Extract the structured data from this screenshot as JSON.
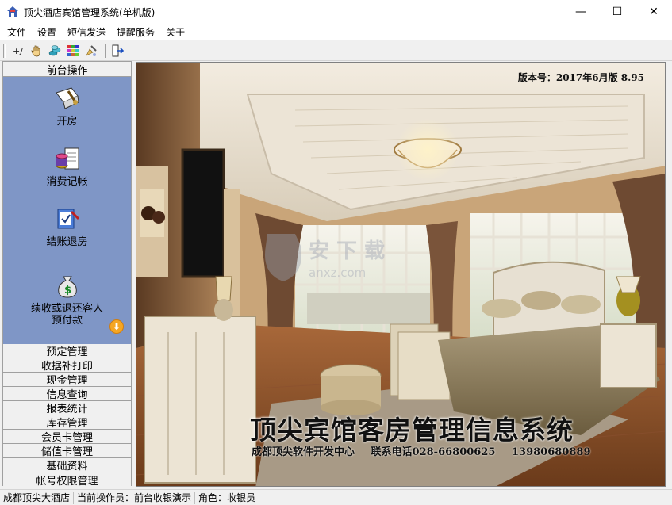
{
  "window": {
    "title": "顶尖酒店宾馆管理系统(单机版)",
    "minimize": "—",
    "maximize": "☐",
    "close": "✕"
  },
  "menu": [
    "文件",
    "设置",
    "短信发送",
    "提醒服务",
    "关于"
  ],
  "toolbar": {
    "icons": [
      "calculator-icon",
      "hand-icon",
      "coins-icon",
      "grid-icon",
      "cleaning-icon",
      "exit-icon"
    ]
  },
  "sidebar": {
    "header": "前台操作",
    "operations": [
      {
        "label": "开房",
        "icon": "open-room-icon"
      },
      {
        "label": "消费记帐",
        "icon": "consumption-icon"
      },
      {
        "label": "结账退房",
        "icon": "checkout-icon"
      },
      {
        "label": "续收或退还客人\n预付款",
        "icon": "money-bag-icon"
      }
    ],
    "list": [
      "预定管理",
      "收据补打印",
      "现金管理",
      "信息查询",
      "报表统计",
      "库存管理",
      "会员卡管理",
      "储值卡管理",
      "基础资料",
      "帐号权限管理"
    ]
  },
  "main": {
    "version": "版本号：2017年6月版 8.95",
    "title": "顶尖宾馆客房管理信息系统",
    "company": "成都顶尖软件开发中心",
    "phone_label": "联系电话028-66800625",
    "phone2": "13980680889",
    "watermark": "anxz.com"
  },
  "status": {
    "hotel": "成都顶尖大酒店",
    "operator": "当前操作员：前台收银演示",
    "role": "角色：收银员"
  },
  "colors": {
    "sidebar_panel": "#7f96c6",
    "arrow": "#f5a623"
  }
}
